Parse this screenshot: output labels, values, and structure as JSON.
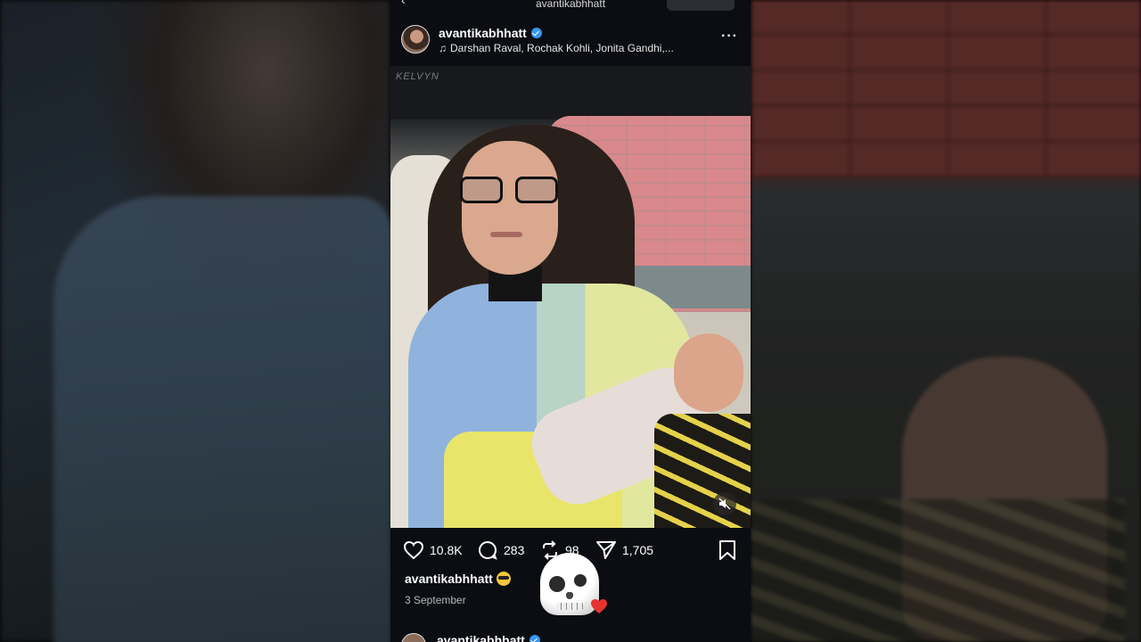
{
  "topbar": {
    "title": "avantikabhhatt",
    "back_icon": "chevron-left-icon"
  },
  "post": {
    "username": "avantikabhhatt",
    "verified": true,
    "music": "Darshan Raval, Rochak Kohli, Jonita Gandhi,...",
    "more_icon": "more-horizontal-icon",
    "video_watermark": "KELVYN"
  },
  "actions": {
    "likes": "10.8K",
    "comments": "283",
    "reposts": "98",
    "shares": "1,705"
  },
  "caption": {
    "username": "avantikabhhatt",
    "date": "3 September"
  },
  "next_post": {
    "username": "avantikabhhatt"
  },
  "colors": {
    "background": "#0b0d12",
    "verified": "#3897f0",
    "text_muted": "#b7b7b7"
  }
}
